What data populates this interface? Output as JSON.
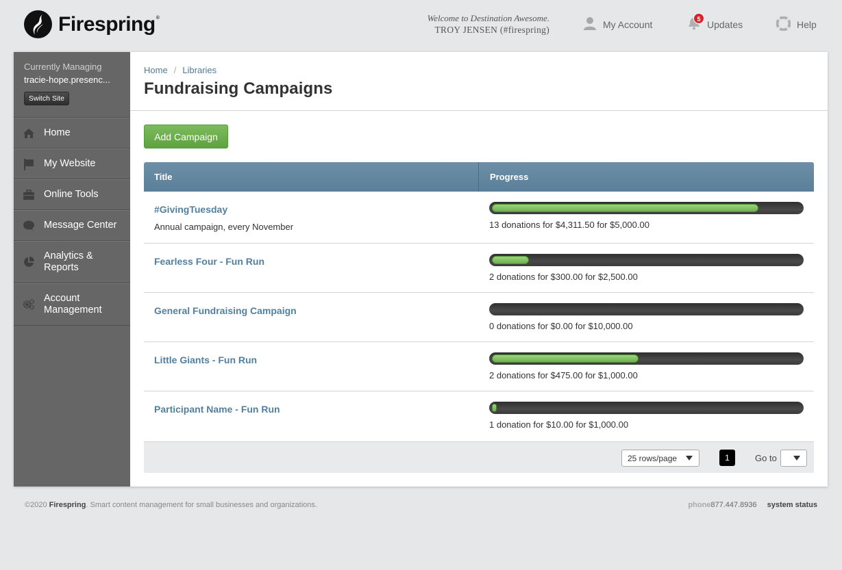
{
  "header": {
    "brand": "Firespring",
    "brand_mark": "®",
    "welcome_line": "Welcome to Destination Awesome.",
    "user_line": "TROY JENSEN (#firespring)",
    "nav": [
      {
        "label": "My Account",
        "icon": "user-icon"
      },
      {
        "label": "Updates",
        "icon": "bell-icon",
        "badge": "5"
      },
      {
        "label": "Help",
        "icon": "lifebuoy-icon"
      }
    ]
  },
  "sidebar": {
    "managing_label": "Currently Managing",
    "site_name": "tracie-hope.presenc...",
    "switch_label": "Switch Site",
    "items": [
      {
        "label": "Home",
        "icon": "home-icon"
      },
      {
        "label": "My Website",
        "icon": "flag-icon"
      },
      {
        "label": "Online Tools",
        "icon": "toolbox-icon"
      },
      {
        "label": "Message Center",
        "icon": "chat-bubble-icon"
      },
      {
        "label": "Analytics & Reports",
        "icon": "pie-chart-icon"
      },
      {
        "label": "Account Management",
        "icon": "gears-icon"
      }
    ]
  },
  "breadcrumb": [
    "Home",
    "Libraries"
  ],
  "breadcrumb_sep": "/",
  "page_title": "Fundraising Campaigns",
  "add_button": "Add Campaign",
  "table": {
    "columns": [
      "Title",
      "Progress"
    ],
    "rows": [
      {
        "title": "#GivingTuesday",
        "description": "Annual campaign, every November",
        "progress": 0.8623,
        "caption": "13 donations for $4,311.50 for $5,000.00"
      },
      {
        "title": "Fearless Four - Fun Run",
        "description": "",
        "progress": 0.12,
        "caption": "2 donations for $300.00 for $2,500.00"
      },
      {
        "title": "General Fundraising Campaign",
        "description": "",
        "progress": 0,
        "caption": "0 donations for $0.00 for $10,000.00"
      },
      {
        "title": "Little Giants - Fun Run",
        "description": "",
        "progress": 0.475,
        "caption": "2 donations for $475.00 for $1,000.00"
      },
      {
        "title": "Participant Name - Fun Run",
        "description": "",
        "progress": 0.01,
        "caption": "1 donation for $10.00 for $1,000.00"
      }
    ]
  },
  "pagination": {
    "rows_per_page": "25 rows/page",
    "current_page": "1",
    "goto_label": "Go to",
    "goto_value": ""
  },
  "footer": {
    "copyright": "©2020 ",
    "brand": "Firespring",
    "tagline": ". Smart content management for small businesses and organizations.",
    "phone_label": "phone",
    "phone": "877.447.8936",
    "system_status": "system status"
  },
  "colors": {
    "accent_link": "#52809f",
    "header_bar": "#5b7f98",
    "progress_fill": "#6db152",
    "add_button": "#5da33f",
    "badge": "#d8232a",
    "sidebar": "#666666"
  }
}
